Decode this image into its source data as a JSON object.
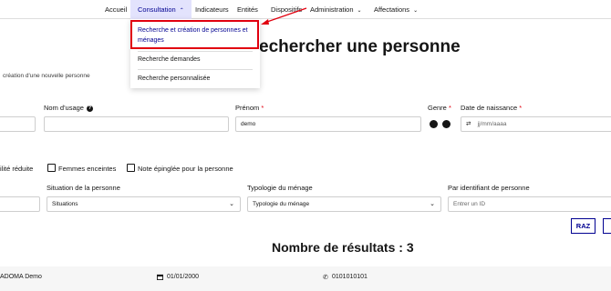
{
  "nav": {
    "items": [
      {
        "label": "Accueil"
      },
      {
        "label": "Consultation"
      },
      {
        "label": "Indicateurs"
      },
      {
        "label": "Entités"
      },
      {
        "label": "Dispositifs"
      },
      {
        "label": "Administration"
      },
      {
        "label": "Affectations"
      }
    ]
  },
  "dropdown": {
    "items": [
      {
        "label_line1": "Recherche et création de personnes et",
        "label_line2": "ménages"
      },
      {
        "label": "Recherche demandes"
      },
      {
        "label": "Recherche personnalisée"
      }
    ]
  },
  "page": {
    "title": "echercher une personne",
    "subtitle": "création d'une nouvelle personne"
  },
  "form": {
    "nom_usage": {
      "label": "Nom d'usage",
      "value": ""
    },
    "prenom": {
      "label": "Prénom",
      "required": "*",
      "value": "demo"
    },
    "genre": {
      "label": "Genre",
      "required": "*"
    },
    "date_naissance": {
      "label": "Date de naissance",
      "required": "*",
      "placeholder": "jj/mm/aaaa"
    },
    "checkboxes": [
      {
        "label": "ilité réduite"
      },
      {
        "label": "Femmes enceintes"
      },
      {
        "label": "Note épinglée pour la personne"
      }
    ],
    "situation": {
      "label": "Situation de la personne",
      "value": "Situations"
    },
    "typologie": {
      "label": "Typologie du ménage",
      "value": "Typologie du ménage"
    },
    "identifiant": {
      "label": "Par identifiant de personne",
      "placeholder": "Entrer un ID"
    }
  },
  "actions": {
    "raz_label": "RAZ"
  },
  "results": {
    "title": "Nombre de résultats : 3",
    "rows": [
      {
        "name": "ADOMA Demo",
        "date": "01/01/2000",
        "phone": "0101010101"
      }
    ]
  },
  "colors": {
    "accent": "#000091",
    "highlight": "#e1000f",
    "nav_active_bg": "#e3e3fd"
  }
}
